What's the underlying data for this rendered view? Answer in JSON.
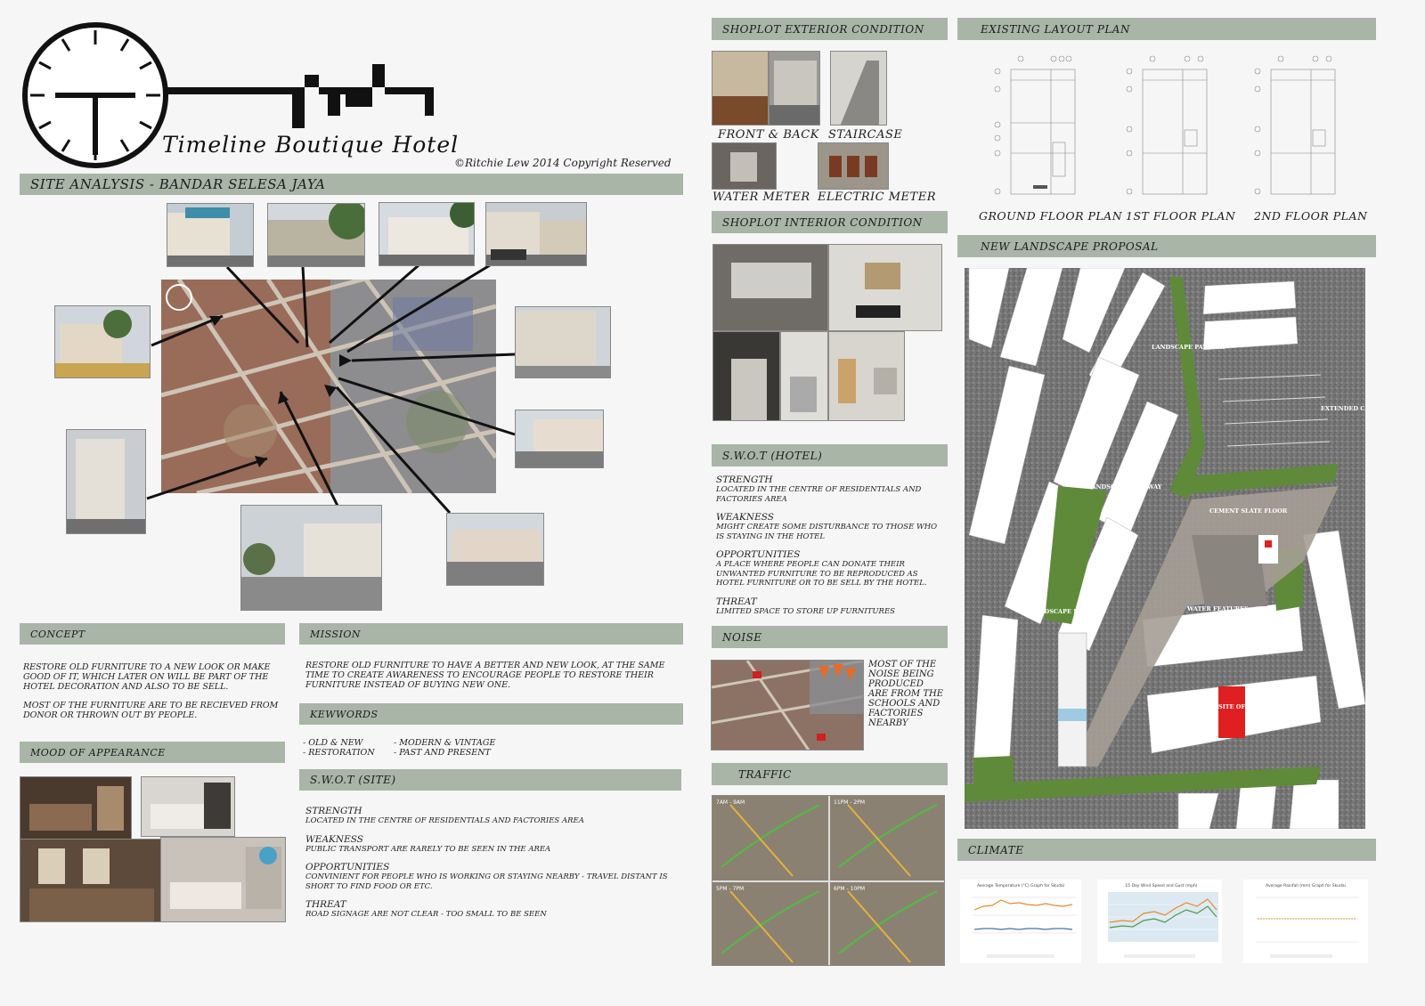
{
  "header": {
    "title": "Timeline Boutique Hotel",
    "copyright": "©Ritchie Lew 2014 Copyright Reserved"
  },
  "sections": {
    "site_analysis": "SITE ANALYSIS  - BANDAR SELESA JAYA",
    "concept": "CONCEPT",
    "mission": "MISSION",
    "keywords": "KEWWORDS",
    "mood": "MOOD OF APPEARANCE",
    "swot_site": "S.W.O.T  (SITE)",
    "exterior": "SHOPLOT EXTERIOR CONDITION",
    "interior": "SHOPLOT INTERIOR CONDITION",
    "swot_hotel": "S.W.O.T  (HOTEL)",
    "noise": "NOISE",
    "traffic": "TRAFFIC",
    "existing_layout": "EXISTING LAYOUT PLAN",
    "landscape": "NEW LANDSCAPE PROPOSAL",
    "climate": "CLIMATE"
  },
  "concept_text": {
    "p1": "RESTORE OLD FURNITURE TO A NEW LOOK OR MAKE GOOD OF IT, WHICH LATER ON WILL BE PART OF THE HOTEL DECORATION AND ALSO TO BE SELL.",
    "p2": "MOST OF THE FURNITURE ARE TO BE RECIEVED FROM DONOR OR THROWN OUT BY PEOPLE."
  },
  "mission_text": "RESTORE OLD FURNITURE TO HAVE A BETTER AND NEW LOOK, AT THE SAME TIME TO CREATE AWARENESS TO ENCOURAGE PEOPLE TO RESTORE THEIR FURNITURE INSTEAD OF BUYING NEW ONE.",
  "keywords_list": {
    "col1": "- OLD & NEW\n- RESTORATION",
    "col2": "- MODERN & VINTAGE\n- PAST AND PRESENT"
  },
  "swot_site": {
    "s_h": "STRENGTH",
    "s": "LOCATED IN THE CENTRE OF RESIDENTIALS AND FACTORIES AREA",
    "w_h": "WEAKNESS",
    "w": "PUBLIC TRANSPORT ARE RARELY TO BE SEEN IN THE AREA",
    "o_h": "OPPORTUNITIES",
    "o": "CONVINIENT FOR PEOPLE WHO IS WORKING OR STAYING NEARBY - TRAVEL DISTANT IS SHORT TO FIND FOOD OR ETC.",
    "t_h": "THREAT",
    "t": "ROAD SIGNAGE ARE NOT CLEAR - TOO SMALL TO BE SEEN"
  },
  "swot_hotel": {
    "s_h": "STRENGTH",
    "s": "LOCATED IN THE CENTRE OF RESIDENTIALS AND FACTORIES AREA",
    "w_h": "WEAKNESS",
    "w": "MIGHT CREATE SOME DISTURBANCE TO THOSE WHO IS STAYING IN THE HOTEL",
    "o_h": "OPPORTUNITIES",
    "o": "A PLACE WHERE PEOPLE CAN DONATE THEIR UNWANTED FURNITURE TO BE REPRODUCED AS HOTEL FURNITURE OR TO BE SELL BY THE HOTEL.",
    "t_h": "THREAT",
    "t": "LIMITED SPACE TO STORE UP FURNITURES"
  },
  "noise_text": "MOST OF THE NOISE BEING PRODUCED ARE FROM THE SCHOOLS AND FACTORIES NEARBY",
  "exterior_captions": {
    "front_back": "FRONT & BACK",
    "staircase": "STAIRCASE",
    "water": "WATER METER",
    "electric": "ELECTRIC METER"
  },
  "floor_plans": {
    "ground": "GROUND FLOOR PLAN",
    "first": "1ST FLOOR PLAN",
    "second": "2ND FLOOR PLAN"
  },
  "landscape_labels": {
    "paveway1": "LANDSCAPE PAVEWAY",
    "paveway2": "LANDSCAPE PAVEWAY",
    "paveway3": "LANDSCAPE PAVEWAY",
    "carpark": "EXTENDED CARPARK",
    "cement": "CEMENT SLATE FLOOR",
    "water": "WATER FEATURES",
    "site_office": "SITE OFFICE"
  },
  "traffic_labels": [
    "7AM - 9AM",
    "11PM - 2PM",
    "5PM - 7PM",
    "6PM - 10PM"
  ],
  "climate_titles": [
    "Average Temperature (°C) Graph for Skudai",
    "15 Day Wind Speed and Gust (mph)",
    "Average Rainfall (mm) Graph for Skudai"
  ],
  "colors": {
    "bar": "#a8b5a7",
    "grass": "#5f8a3a",
    "road": "#7b7b7b",
    "accent_red": "#e02020"
  }
}
